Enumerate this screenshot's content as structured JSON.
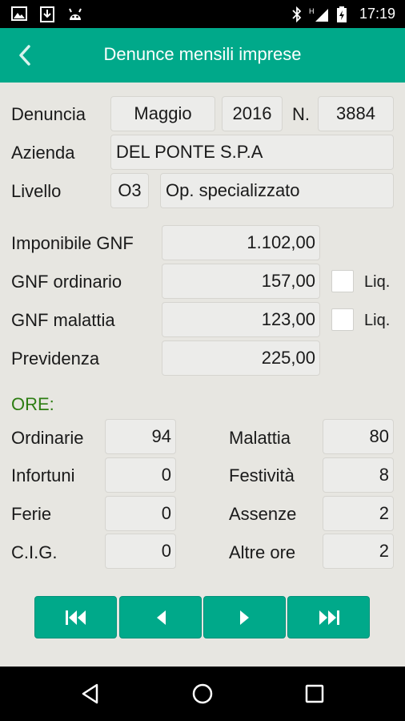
{
  "status_bar": {
    "time": "17:19",
    "icons": [
      "image-icon",
      "download-icon",
      "android-icon",
      "bluetooth-icon",
      "signal-icon",
      "battery-icon"
    ]
  },
  "app_bar": {
    "title": "Denunce mensili imprese",
    "back_icon": "chevron-left-icon"
  },
  "header": {
    "denuncia_label": "Denuncia",
    "month": "Maggio",
    "year": "2016",
    "number_label": "N.",
    "number": "3884",
    "azienda_label": "Azienda",
    "azienda": "DEL PONTE S.P.A",
    "livello_label": "Livello",
    "livello_code": "O3",
    "livello_desc": "Op. specializzato"
  },
  "amounts": {
    "imponibile_label": "Imponibile GNF",
    "imponibile": "1.102,00",
    "ordinario_label": "GNF ordinario",
    "ordinario": "157,00",
    "ordinario_liq": "Liq.",
    "malattia_label": "GNF malattia",
    "malattia": "123,00",
    "malattia_liq": "Liq.",
    "previdenza_label": "Previdenza",
    "previdenza": "225,00"
  },
  "ore": {
    "title": "ORE:",
    "ordinarie_label": "Ordinarie",
    "ordinarie": "94",
    "infortuni_label": "Infortuni",
    "infortuni": "0",
    "ferie_label": "Ferie",
    "ferie": "0",
    "cig_label": "C.I.G.",
    "cig": "0",
    "malattia_label": "Malattia",
    "malattia": "80",
    "festivita_label": "Festività",
    "festivita": "8",
    "assenze_label": "Assenze",
    "assenze": "2",
    "altre_label": "Altre ore",
    "altre": "2"
  },
  "nav_buttons": [
    "first-record-icon",
    "previous-record-icon",
    "next-record-icon",
    "last-record-icon"
  ],
  "system_nav": [
    "back-triangle-icon",
    "home-circle-icon",
    "recents-square-icon"
  ],
  "colors": {
    "primary": "#00a98a",
    "background": "#e7e6e1",
    "field": "#ececea",
    "ore_title": "#2d7d12"
  }
}
